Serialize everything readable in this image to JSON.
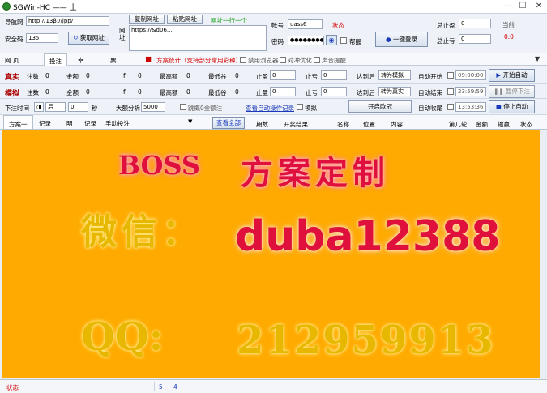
{
  "window": {
    "title": "SGWin-HC —— 土",
    "controls": {
      "minimize": "—",
      "maximize": "☐",
      "close": "✕"
    }
  },
  "left_panel": {
    "nav_label": "导航网",
    "nav_value": "http://13β://jpp/",
    "safe_label": "安全码",
    "safe_value": "135",
    "fetch_button": "获取网址"
  },
  "url_panel": {
    "side_label": "网址",
    "copy_button": "复制网址",
    "paste_button": "粘贴网址",
    "hint": "网址一行一个",
    "url_text": "https://&d06..."
  },
  "login": {
    "account_label": "帐号",
    "account_value": "uass6",
    "status_label": "状态",
    "password_label": "密码",
    "password_value": "●●●●●●●●●●",
    "remember_label": "帮醒",
    "login_button": "一键登录"
  },
  "totals": {
    "stop_win_label": "总止盈",
    "stop_win_value": "0",
    "stop_loss_label": "总止亏",
    "stop_loss_value": "0",
    "current_label": "当前",
    "current_value": "0.0"
  },
  "tabs": [
    {
      "label": "网 页"
    },
    {
      "label": "投注"
    },
    {
      "label": "幸"
    },
    {
      "label": "票"
    }
  ],
  "toolbar": {
    "plan_stats": "方案统计（支持部分常用彩种）",
    "disable_browser": "禁用浏览器",
    "combine_optimize": "对冲优化",
    "sound_alert": "声音提醒"
  },
  "real_row": {
    "label": "真实",
    "bets_label": "注数",
    "bets_value": "0",
    "amount_label": "金额",
    "amount_value": "0",
    "p_label": "f",
    "p_value": "0",
    "highest_label": "最高额",
    "highest_value": "0",
    "lowest_label": "最低谷",
    "lowest_value": "0",
    "stopwin_label": "止盈",
    "stopwin_value": "0",
    "stoploss_label": "止亏",
    "stoploss_value": "0",
    "after_label": "达到后",
    "after_value": "转为模拟",
    "auto_start_label": "自动开始",
    "auto_start_time": "09:00:00",
    "start_button": "开始自动"
  },
  "sim_row": {
    "label": "模拟",
    "bets_label": "注数",
    "bets_value": "0",
    "amount_label": "金额",
    "amount_value": "0",
    "p_label": "f",
    "p_value": "0",
    "highest_label": "最高额",
    "highest_value": "0",
    "lowest_label": "最低谷",
    "lowest_value": "0",
    "stopwin_label": "止盈",
    "stopwin_value": "0",
    "stoploss_label": "止亏",
    "stoploss_value": "0",
    "after_label": "达到后",
    "after_value": "转为真实",
    "auto_end_label": "自动结束",
    "auto_end_time": "23:59:59",
    "pause_button": "暂停下注"
  },
  "bet_row": {
    "time_label": "下注时间",
    "timing_value": "后",
    "seconds_value": "0",
    "seconds_label": "秒",
    "bigbet_label": "大额分拆",
    "bigbet_value": "5000",
    "skip_label": "跳概0金额注",
    "view_link": "查看自动操作记录",
    "mode_label": "模拟",
    "double_open": "开启欧冠",
    "auto_stop_label": "自动收尾",
    "auto_stop_time": "13:53:36",
    "stop_button": "停止自动"
  },
  "lower_tabs": [
    {
      "label": "方案一"
    },
    {
      "label": "记录"
    },
    {
      "label": "明"
    },
    {
      "label": "记录"
    },
    {
      "label": "手动投注"
    }
  ],
  "table": {
    "view_all_button": "查看全部",
    "columns": [
      "期数",
      "开奖结果",
      "名称",
      "位置",
      "内容",
      "第几轮",
      "金额",
      "输赢",
      "状态"
    ]
  },
  "banner": {
    "boss": "BOSS",
    "plan": "方案定制",
    "wechat_label": "微信：",
    "wechat_id": "duba12388",
    "qq_label": "QQ:",
    "qq_id": "212959913"
  },
  "statusbar": {
    "status_label": "状态",
    "s2": "5",
    "s3": "4"
  },
  "colors": {
    "banner_bg": "#ffaa00",
    "red_text": "#e0103c",
    "gold_text": "#e8b800",
    "accent_blue": "#1a39b8"
  }
}
